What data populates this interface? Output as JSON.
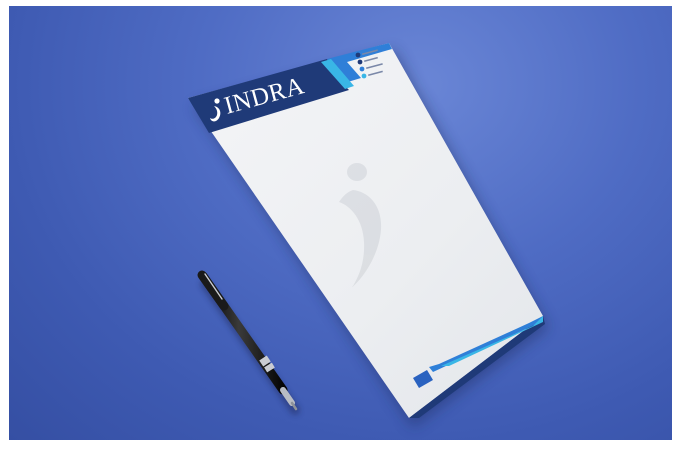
{
  "letterhead": {
    "brand": "INDRA",
    "colors": {
      "background": "#4f6cc4",
      "paper": "#eeeff1",
      "navy": "#1f3a78",
      "blue": "#2f7fd8",
      "cyan": "#39b6e6"
    },
    "contact_icons": [
      "phone-icon",
      "globe-icon",
      "mail-icon",
      "location-icon"
    ]
  },
  "pen": {
    "color": "#111111",
    "accent": "#c9ccd2"
  }
}
